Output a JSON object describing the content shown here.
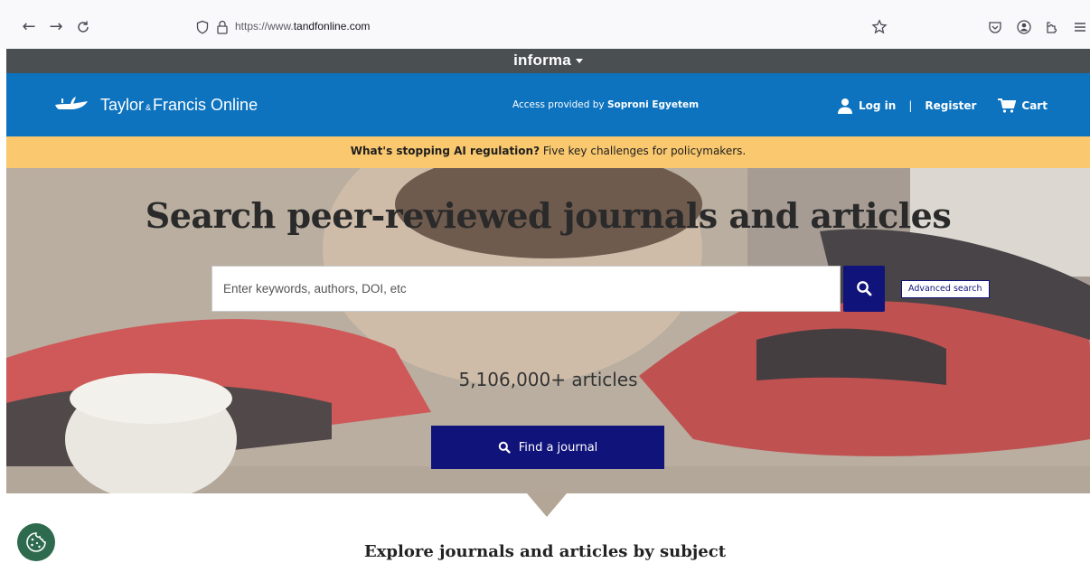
{
  "browser": {
    "url_prefix": "https://www.",
    "url_domain": "tandfonline.com"
  },
  "informa": {
    "logo": "informa"
  },
  "header": {
    "brand_name_1": "Taylor",
    "brand_amp": "&",
    "brand_name_2": "Francis Online",
    "access_prefix": "Access provided by ",
    "access_org": "Soproni Egyetem",
    "login_label": "Log in",
    "separator": "|",
    "register_label": "Register",
    "cart_label": "Cart"
  },
  "announcement": {
    "bold": "What's stopping AI regulation?",
    "text": " Five key challenges for policymakers."
  },
  "hero": {
    "title": "Search peer-reviewed journals and articles",
    "search_placeholder": "Enter keywords, authors, DOI, etc",
    "advanced_search_label": "Advanced search",
    "articles_count": "5,106,000+ articles",
    "find_journal_label": "Find a journal"
  },
  "explore": {
    "title": "Explore journals and articles by subject"
  },
  "colors": {
    "informa_bar": "#4a4f51",
    "header_blue": "#0d73bf",
    "announcement_yellow": "#f9c86f",
    "navy_button": "#10137a",
    "cookie_green": "#2e6b4e"
  }
}
